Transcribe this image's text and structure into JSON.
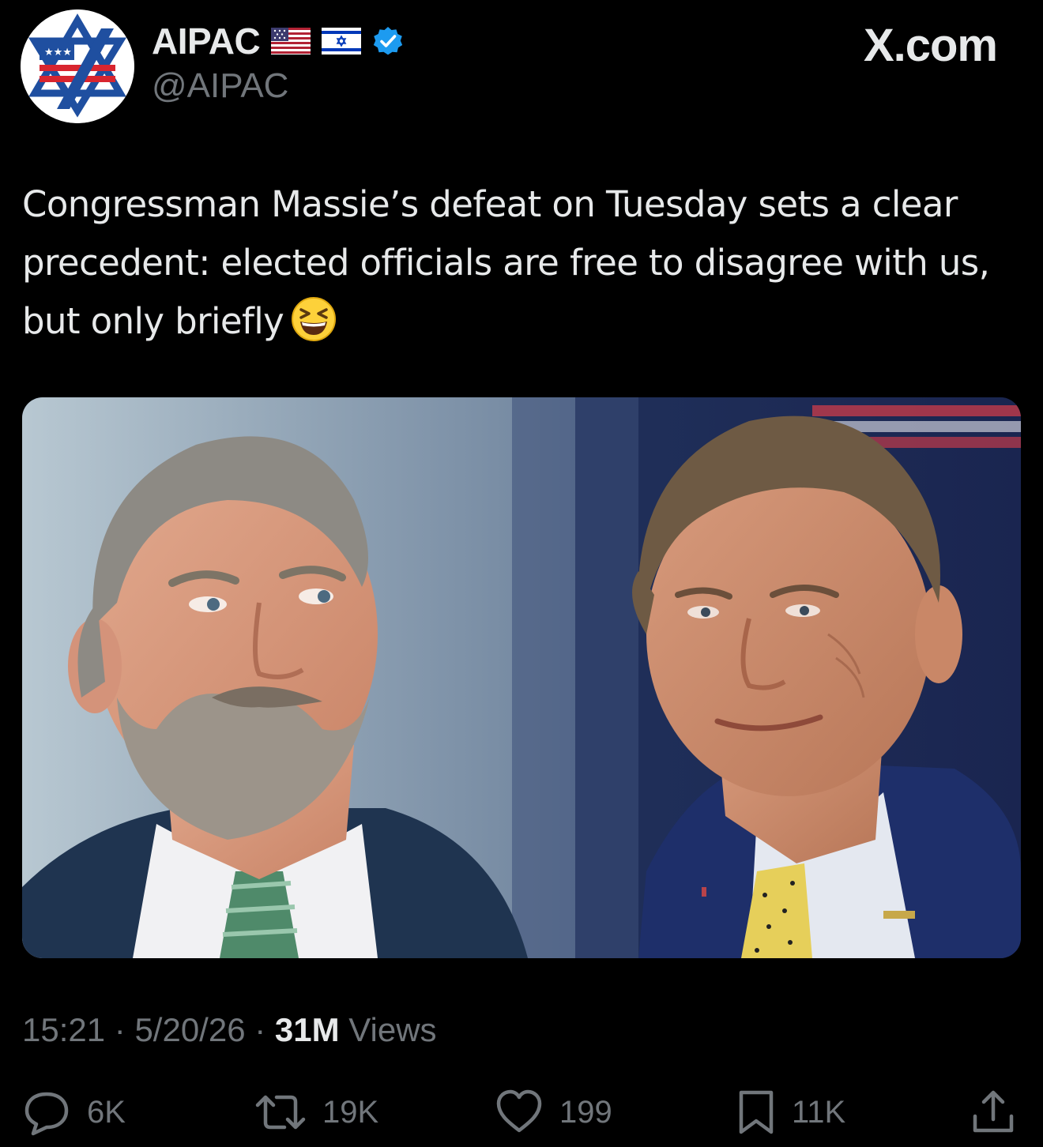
{
  "author": {
    "display_name": "AIPAC",
    "handle": "@AIPAC",
    "verified": true,
    "flags": [
      "us-flag-icon",
      "israel-flag-icon"
    ]
  },
  "site_mark": "X.com",
  "tweet": {
    "text": "Congressman Massie’s defeat on Tuesday sets a clear precedent: elected officials are free to disagree with us, but only briefly",
    "emoji": "grinning-squinting-face-emoji"
  },
  "media": {
    "type": "photo",
    "subjects": [
      "left-portrait",
      "right-portrait"
    ]
  },
  "meta": {
    "time": "15:21",
    "separator": " · ",
    "date": "5/20/26",
    "views_count": "31M",
    "views_label": " Views"
  },
  "actions": {
    "reply_count": "6K",
    "repost_count": "19K",
    "like_count": "199",
    "bookmark_count": "11K"
  },
  "colors": {
    "background": "#000000",
    "text": "#e7e9ea",
    "muted": "#71767b",
    "verified": "#1d9bf0"
  }
}
